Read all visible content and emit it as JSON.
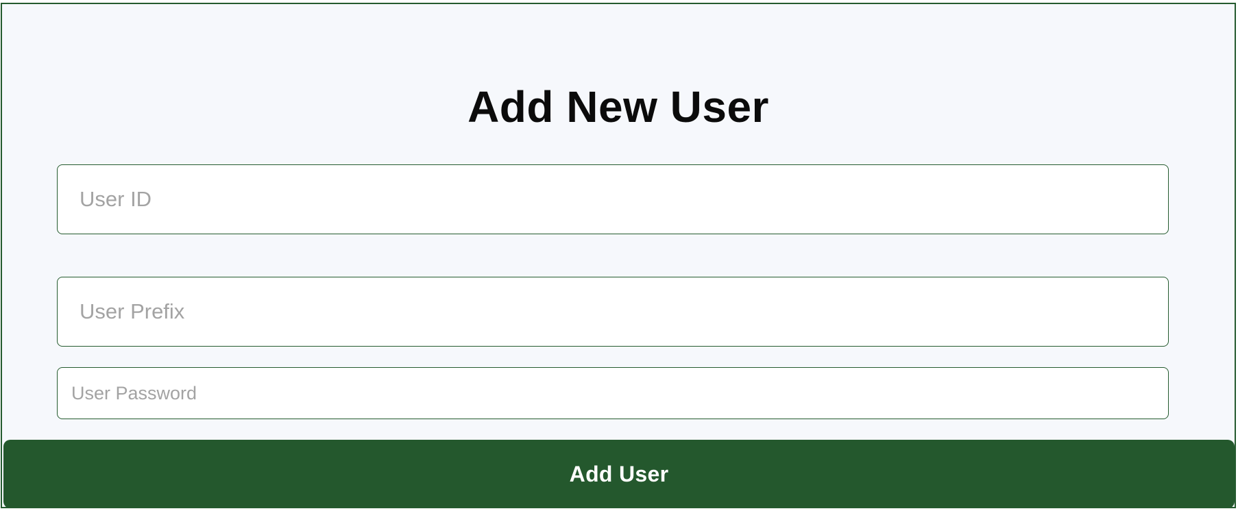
{
  "form": {
    "title": "Add New User",
    "fields": {
      "user_id": {
        "placeholder": "User ID",
        "value": ""
      },
      "user_prefix": {
        "placeholder": "User Prefix",
        "value": ""
      },
      "user_password": {
        "placeholder": "User Password",
        "value": ""
      }
    },
    "submit_label": "Add User"
  },
  "colors": {
    "accent": "#245a2e",
    "background": "#f6f8fc",
    "placeholder": "#a3a3a3"
  }
}
